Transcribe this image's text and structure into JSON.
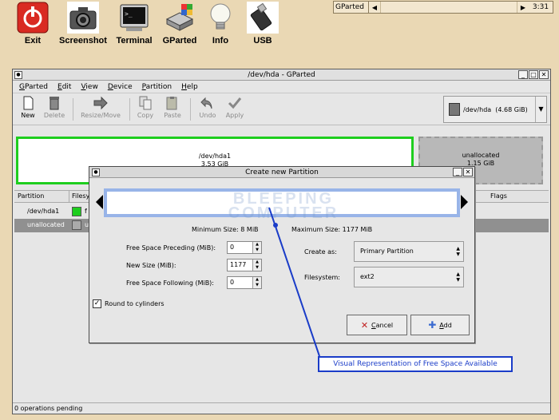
{
  "launcher": {
    "items": [
      {
        "label": "Exit",
        "icon": "power-icon"
      },
      {
        "label": "Screenshot",
        "icon": "camera-icon"
      },
      {
        "label": "Terminal",
        "icon": "terminal-icon"
      },
      {
        "label": "GParted",
        "icon": "gparted-icon"
      },
      {
        "label": "Info",
        "icon": "lightbulb-icon"
      },
      {
        "label": "USB",
        "icon": "usb-icon"
      }
    ]
  },
  "taskbar": {
    "task": "GParted",
    "time": "3:31"
  },
  "window": {
    "title": "/dev/hda - GParted",
    "menu": [
      "GParted",
      "Edit",
      "View",
      "Device",
      "Partition",
      "Help"
    ],
    "toolbar": {
      "new": "New",
      "delete": "Delete",
      "resize": "Resize/Move",
      "copy": "Copy",
      "paste": "Paste",
      "undo": "Undo",
      "apply": "Apply"
    },
    "device": "/dev/hda",
    "device_size": "(4.68 GiB)",
    "diskmap": {
      "used_name": "/dev/hda1",
      "used_size": "3.53 GiB",
      "free_name": "unallocated",
      "free_size": "1.15 GiB"
    },
    "columns": {
      "partition": "Partition",
      "filesystem": "Filesys",
      "flags": "Flags"
    },
    "rows": [
      {
        "partition": "/dev/hda1",
        "fs": "f"
      },
      {
        "partition": "unallocated",
        "fs": "u"
      }
    ],
    "status": "0 operations pending",
    "colors": {
      "used": "#1ece1e",
      "selected_row": "#909090"
    }
  },
  "dialog": {
    "title": "Create new Partition",
    "watermark_line1": "BLEEPING",
    "watermark_line2": "COMPUTER",
    "min_size": "Minimum Size: 8 MiB",
    "max_size": "Maximum Size: 1177 MiB",
    "free_preceding_label": "Free Space Preceding (MiB):",
    "free_preceding_value": "0",
    "new_size_label": "New Size (MiB):",
    "new_size_value": "1177",
    "free_following_label": "Free Space Following (MiB):",
    "free_following_value": "0",
    "round_label": "Round to cylinders",
    "round_checked": true,
    "create_as_label": "Create as:",
    "create_as_value": "Primary Partition",
    "filesystem_label": "Filesystem:",
    "filesystem_value": "ext2",
    "cancel": "Cancel",
    "add": "Add"
  },
  "callout": {
    "text": "Visual Representation of Free Space Available",
    "color": "#1a3cc8"
  }
}
